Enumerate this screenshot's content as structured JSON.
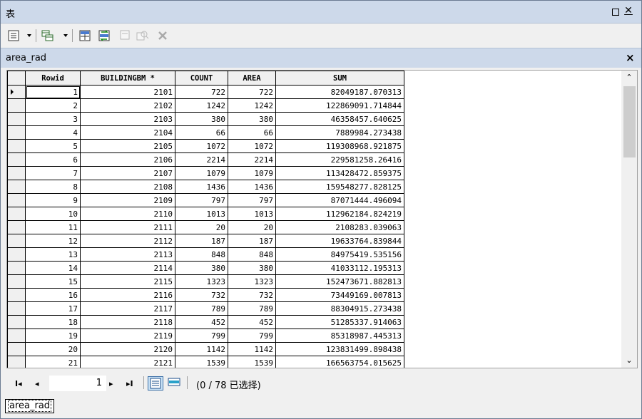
{
  "window": {
    "title": "表"
  },
  "table_tab": {
    "name": "area_rad"
  },
  "grid": {
    "columns": [
      "Rowid",
      "BUILDINGBM *",
      "COUNT",
      "AREA",
      "SUM"
    ],
    "rows": [
      [
        "1",
        "2101",
        "722",
        "722",
        "82049187.070313"
      ],
      [
        "2",
        "2102",
        "1242",
        "1242",
        "122869091.714844"
      ],
      [
        "3",
        "2103",
        "380",
        "380",
        "46358457.640625"
      ],
      [
        "4",
        "2104",
        "66",
        "66",
        "7889984.273438"
      ],
      [
        "5",
        "2105",
        "1072",
        "1072",
        "119308968.921875"
      ],
      [
        "6",
        "2106",
        "2214",
        "2214",
        "229581258.26416"
      ],
      [
        "7",
        "2107",
        "1079",
        "1079",
        "113428472.859375"
      ],
      [
        "8",
        "2108",
        "1436",
        "1436",
        "159548277.828125"
      ],
      [
        "9",
        "2109",
        "797",
        "797",
        "87071444.496094"
      ],
      [
        "10",
        "2110",
        "1013",
        "1013",
        "112962184.824219"
      ],
      [
        "11",
        "2111",
        "20",
        "20",
        "2108283.039063"
      ],
      [
        "12",
        "2112",
        "187",
        "187",
        "19633764.839844"
      ],
      [
        "13",
        "2113",
        "848",
        "848",
        "84975419.535156"
      ],
      [
        "14",
        "2114",
        "380",
        "380",
        "41033112.195313"
      ],
      [
        "15",
        "2115",
        "1323",
        "1323",
        "152473671.882813"
      ],
      [
        "16",
        "2116",
        "732",
        "732",
        "73449169.007813"
      ],
      [
        "17",
        "2117",
        "789",
        "789",
        "88304915.273438"
      ],
      [
        "18",
        "2118",
        "452",
        "452",
        "51285337.914063"
      ],
      [
        "19",
        "2119",
        "799",
        "799",
        "85318987.445313"
      ],
      [
        "20",
        "2120",
        "1142",
        "1142",
        "123831499.898438"
      ],
      [
        "21",
        "2121",
        "1539",
        "1539",
        "166563754.015625"
      ]
    ]
  },
  "navigation": {
    "current_record": "1",
    "selection_info": "(0 / 78 已选择)"
  },
  "bottom_tab": {
    "label": "area_rad"
  },
  "colors": {
    "title_bar": "#cdd9ea",
    "background": "#f0f0f0"
  }
}
